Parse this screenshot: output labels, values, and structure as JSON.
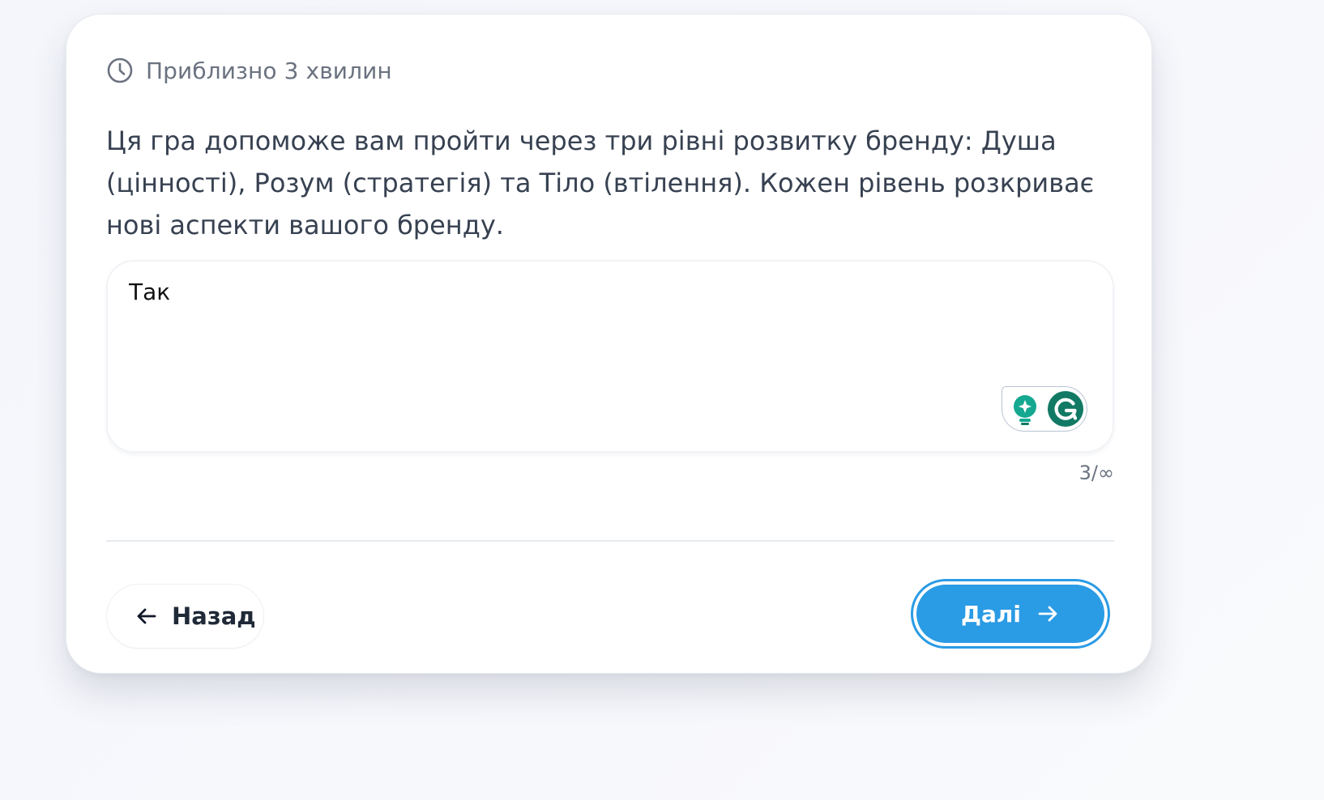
{
  "header": {
    "time_estimate": "Приблизно 3 хвилин",
    "time_icon": "clock-icon"
  },
  "description": "Ця гра допоможе вам пройти через три рівні розвитку бренду: Душа (цінності), Розум (стратегія) та Тіло (втілення). Кожен рівень розкриває нові аспекти вашого бренду.",
  "answer": {
    "value": "Так",
    "char_count": "3/∞",
    "grammarly_icons": [
      "lightbulb-icon",
      "grammarly-icon"
    ]
  },
  "navigation": {
    "back_label": "Назад",
    "back_icon": "arrow-left-icon",
    "next_label": "Далі",
    "next_icon": "arrow-right-icon"
  },
  "colors": {
    "accent": "#2a9be5",
    "grammarly_green": "#15a890",
    "grammarly_dark": "#127a64",
    "text_primary": "#374151",
    "text_muted": "#6b7280"
  }
}
